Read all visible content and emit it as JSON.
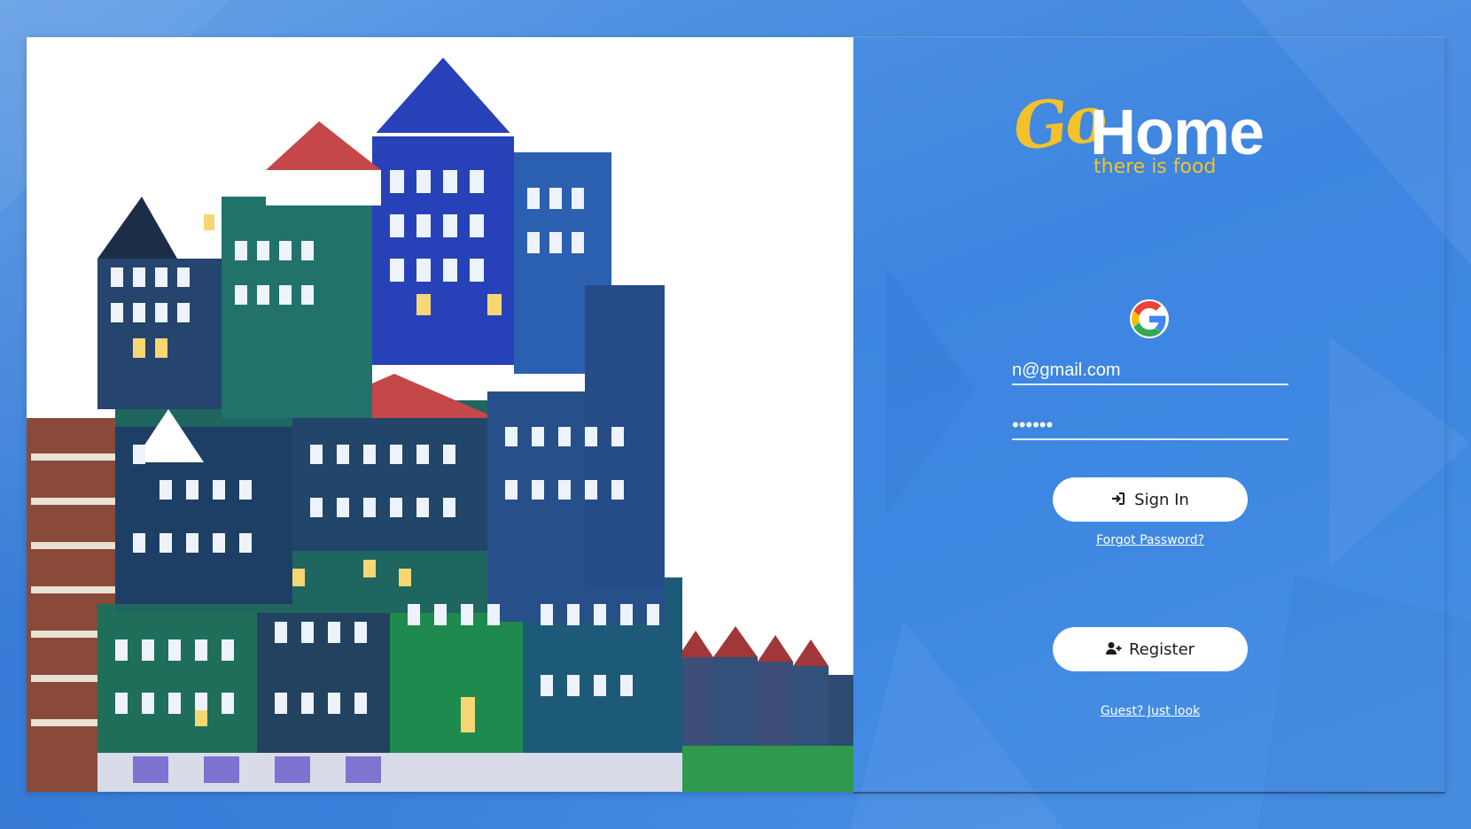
{
  "brand": {
    "logo_go": "Go",
    "logo_home": "Home",
    "tagline": "there is food"
  },
  "login": {
    "google_icon": "google-icon",
    "email_value": "n@gmail.com",
    "password_value": "••••••",
    "signin_label": "Sign In",
    "signin_icon": "sign-in-icon",
    "forgot_label": "Forgot Password?",
    "register_label": "Register",
    "register_icon": "user-plus-icon",
    "guest_label": "Guest? Just look"
  },
  "colors": {
    "background": "#4a8fe0",
    "brand_yellow": "#f3c22a",
    "button_bg": "#ffffff",
    "text_light": "#ffffff"
  }
}
